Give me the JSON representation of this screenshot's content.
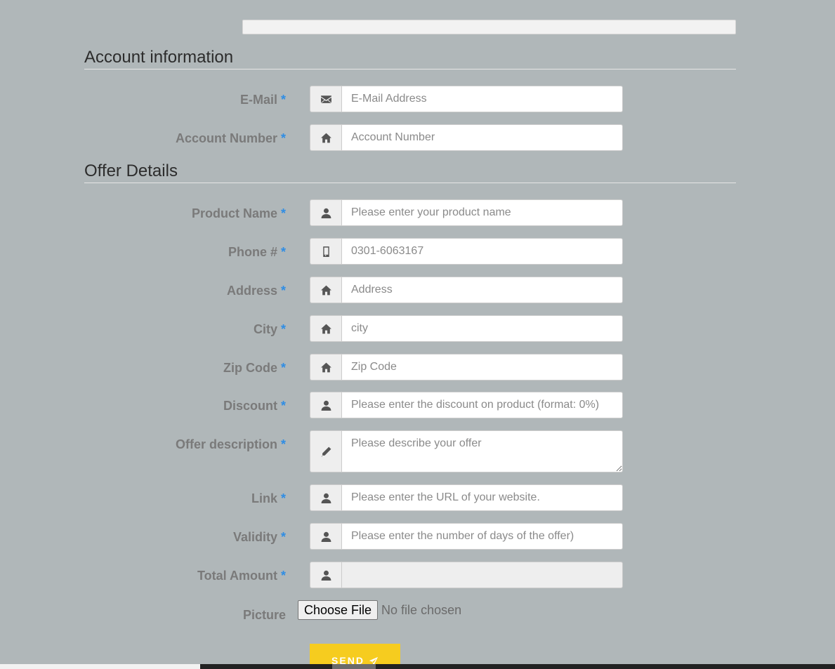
{
  "sections": {
    "account": "Account information",
    "offer": "Offer Details"
  },
  "required_mark": "*",
  "fields": [
    {
      "label": "E-Mail",
      "placeholder": "E-Mail Address",
      "icon": "envelope-icon"
    },
    {
      "label": "Account Number",
      "placeholder": "Account Number",
      "icon": "home-icon"
    },
    {
      "label": "Product Name",
      "placeholder": "Please enter your product name",
      "icon": "user-icon"
    },
    {
      "label": "Phone #",
      "placeholder": "0301-6063167",
      "icon": "phone-icon"
    },
    {
      "label": "Address",
      "placeholder": "Address",
      "icon": "home-icon"
    },
    {
      "label": "City",
      "placeholder": "city",
      "icon": "home-icon"
    },
    {
      "label": "Zip Code",
      "placeholder": "Zip Code",
      "icon": "home-icon"
    },
    {
      "label": "Discount",
      "placeholder": "Please enter the discount on product (format: 0%)",
      "icon": "user-icon"
    },
    {
      "label": "Offer description",
      "placeholder": "Please describe your offer",
      "icon": "pencil-icon"
    },
    {
      "label": "Link",
      "placeholder": "Please enter the URL of your website.",
      "icon": "user-icon"
    },
    {
      "label": "Validity",
      "placeholder": "Please enter the number of days of the offer)",
      "icon": "user-icon"
    },
    {
      "label": "Total Amount",
      "placeholder": "",
      "icon": "user-icon"
    }
  ],
  "picture": {
    "label": "Picture",
    "button": "Choose File",
    "status": "No file chosen"
  },
  "send_button": "SEND"
}
